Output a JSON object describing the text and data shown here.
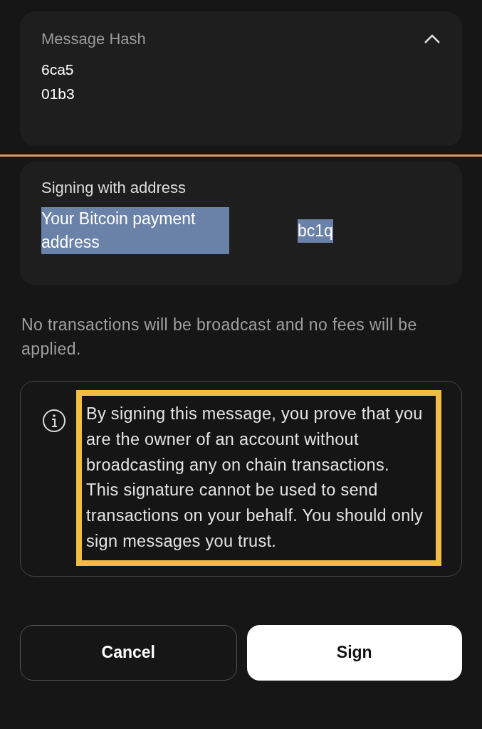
{
  "message_hash": {
    "title": "Message Hash",
    "expanded": true,
    "lines": [
      "6ca5",
      "01b3"
    ]
  },
  "signing": {
    "title": "Signing with address",
    "address_label": "Your Bitcoin payment address",
    "address": "bc1q",
    "highlighted": true
  },
  "note": "No transactions will be broadcast and no fees will be applied.",
  "info": {
    "text": "By signing this message, you prove that you are the owner of an account without broadcasting any on chain transactions. This signature cannot be used to send transactions on your behalf. You should only sign messages you trust.",
    "annotated": true
  },
  "buttons": [
    {
      "label": "Cancel",
      "kind": "secondary"
    },
    {
      "label": "Sign",
      "kind": "primary"
    }
  ]
}
